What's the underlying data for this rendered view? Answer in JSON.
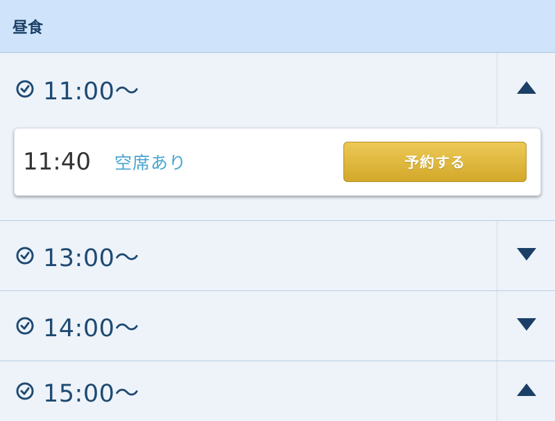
{
  "section": {
    "title": "昼食"
  },
  "slots": [
    {
      "time": "11:00〜",
      "toggle_icon": "chevron-up-icon"
    },
    {
      "time": "13:00〜",
      "toggle_icon": "chevron-down-icon"
    },
    {
      "time": "14:00〜",
      "toggle_icon": "chevron-down-icon"
    },
    {
      "time": "15:00〜",
      "toggle_icon": "chevron-up-icon"
    }
  ],
  "availability": {
    "time": "11:40",
    "status": "空席あり",
    "reserve_label": "予約する"
  },
  "colors": {
    "header_bg": "#cfe4fb",
    "page_bg": "#eef3fa",
    "accent_text": "#1e4a72",
    "status_text": "#4aa5cf",
    "button_gold": "#dcb23a"
  }
}
